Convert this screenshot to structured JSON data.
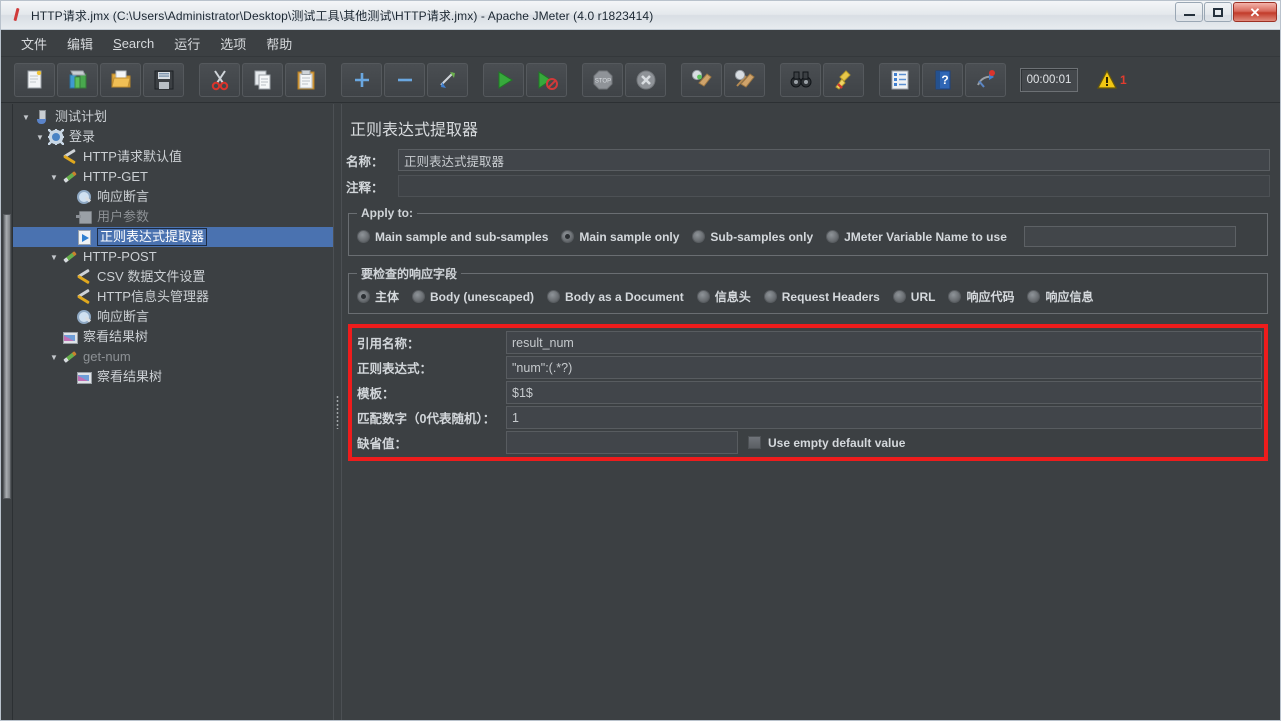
{
  "window": {
    "title": "HTTP请求.jmx (C:\\Users\\Administrator\\Desktop\\测试工具\\其他测试\\HTTP请求.jmx) - Apache JMeter (4.0 r1823414)",
    "app_icon": "jmeter-feather-icon",
    "controls": {
      "minimize": "minimize-button",
      "maximize": "maximize-button",
      "close": "close-button"
    }
  },
  "menubar": {
    "items": [
      {
        "label": "文件",
        "mnemonic": ""
      },
      {
        "label": "编辑",
        "mnemonic": ""
      },
      {
        "label": "Search",
        "mnemonic": "S"
      },
      {
        "label": "运行",
        "mnemonic": ""
      },
      {
        "label": "选项",
        "mnemonic": ""
      },
      {
        "label": "帮助",
        "mnemonic": ""
      }
    ]
  },
  "toolbar": {
    "buttons": [
      {
        "name": "new-icon",
        "tip": "New"
      },
      {
        "name": "templates-icon",
        "tip": "Templates"
      },
      {
        "name": "open-icon",
        "tip": "Open"
      },
      {
        "name": "save-icon",
        "tip": "Save"
      },
      {
        "name": "cut-icon",
        "tip": "Cut"
      },
      {
        "name": "copy-icon",
        "tip": "Copy"
      },
      {
        "name": "paste-icon",
        "tip": "Paste"
      },
      {
        "name": "expand-icon",
        "tip": "Expand All"
      },
      {
        "name": "collapse-icon",
        "tip": "Collapse All"
      },
      {
        "name": "toggle-icon",
        "tip": "Toggle"
      },
      {
        "name": "start-icon",
        "tip": "Start"
      },
      {
        "name": "start-no-pauses-icon",
        "tip": "Start no pauses"
      },
      {
        "name": "stop-icon",
        "tip": "Stop"
      },
      {
        "name": "shutdown-icon",
        "tip": "Shutdown"
      },
      {
        "name": "clear-icon",
        "tip": "Clear"
      },
      {
        "name": "clear-all-icon",
        "tip": "Clear All"
      },
      {
        "name": "search-icon",
        "tip": "Search"
      },
      {
        "name": "reset-search-icon",
        "tip": "Reset Search"
      },
      {
        "name": "function-helper-icon",
        "tip": "Function Helper Dialog"
      },
      {
        "name": "help-icon",
        "tip": "Help"
      },
      {
        "name": "undo-redo-icon",
        "tip": "Undo"
      }
    ],
    "timer": "00:00:01",
    "warning_count": "1",
    "warning_icon": "warning-triangle-icon"
  },
  "tree": {
    "nodes": [
      {
        "label": "测试计划",
        "indent": 0,
        "twisty": "open",
        "icon": "test-plan-icon",
        "selected": false,
        "disabled": false
      },
      {
        "label": "登录",
        "indent": 1,
        "twisty": "open",
        "icon": "thread-group-icon",
        "selected": false,
        "disabled": false
      },
      {
        "label": "HTTP请求默认值",
        "indent": 2,
        "twisty": "none",
        "icon": "config-wrench-icon",
        "selected": false,
        "disabled": false
      },
      {
        "label": "HTTP-GET",
        "indent": 2,
        "twisty": "open",
        "icon": "http-sampler-icon",
        "selected": false,
        "disabled": false
      },
      {
        "label": "响应断言",
        "indent": 3,
        "twisty": "none",
        "icon": "assertion-icon",
        "selected": false,
        "disabled": false
      },
      {
        "label": "用户参数",
        "indent": 3,
        "twisty": "none",
        "icon": "user-parameters-icon",
        "selected": false,
        "disabled": true
      },
      {
        "label": "正则表达式提取器",
        "indent": 3,
        "twisty": "none",
        "icon": "regex-extractor-icon",
        "selected": true,
        "disabled": false
      },
      {
        "label": "HTTP-POST",
        "indent": 2,
        "twisty": "open",
        "icon": "http-sampler-icon",
        "selected": false,
        "disabled": false
      },
      {
        "label": "CSV 数据文件设置",
        "indent": 3,
        "twisty": "none",
        "icon": "config-wrench-icon",
        "selected": false,
        "disabled": false
      },
      {
        "label": "HTTP信息头管理器",
        "indent": 3,
        "twisty": "none",
        "icon": "config-wrench-icon",
        "selected": false,
        "disabled": false
      },
      {
        "label": "响应断言",
        "indent": 3,
        "twisty": "none",
        "icon": "assertion-icon",
        "selected": false,
        "disabled": false
      },
      {
        "label": "察看结果树",
        "indent": 2,
        "twisty": "none",
        "icon": "view-results-tree-icon",
        "selected": false,
        "disabled": false
      },
      {
        "label": "get-num",
        "indent": 2,
        "twisty": "open",
        "icon": "http-sampler-icon",
        "selected": false,
        "disabled": true
      },
      {
        "label": "察看结果树",
        "indent": 3,
        "twisty": "none",
        "icon": "view-results-tree-icon",
        "selected": false,
        "disabled": false
      }
    ]
  },
  "panel": {
    "title": "正则表达式提取器",
    "name_label": "名称：",
    "name_value": "正则表达式提取器",
    "comment_label": "注释：",
    "comment_value": "",
    "apply_to": {
      "legend": "Apply to:",
      "options": [
        {
          "label": "Main sample and sub-samples",
          "selected": false
        },
        {
          "label": "Main sample only",
          "selected": true
        },
        {
          "label": "Sub-samples only",
          "selected": false
        },
        {
          "label": "JMeter Variable Name to use",
          "selected": false
        }
      ],
      "variable_value": ""
    },
    "response_field": {
      "legend": "要检查的响应字段",
      "options": [
        {
          "label": "主体",
          "selected": true
        },
        {
          "label": "Body (unescaped)",
          "selected": false
        },
        {
          "label": "Body as a Document",
          "selected": false
        },
        {
          "label": "信息头",
          "selected": false
        },
        {
          "label": "Request Headers",
          "selected": false
        },
        {
          "label": "URL",
          "selected": false
        },
        {
          "label": "响应代码",
          "selected": false
        },
        {
          "label": "响应信息",
          "selected": false
        }
      ]
    },
    "extractor": {
      "highlight_color": "#ee1c1c",
      "fields": [
        {
          "label": "引用名称：",
          "value": "result_num"
        },
        {
          "label": "正则表达式：",
          "value": "\"num\":(.*?)"
        },
        {
          "label": "模板：",
          "value": "$1$"
        },
        {
          "label": "匹配数字（0代表随机）：",
          "value": "1"
        }
      ],
      "default_label": "缺省值：",
      "default_value": "",
      "use_empty_label": "Use empty default value",
      "use_empty_checked": false
    }
  }
}
